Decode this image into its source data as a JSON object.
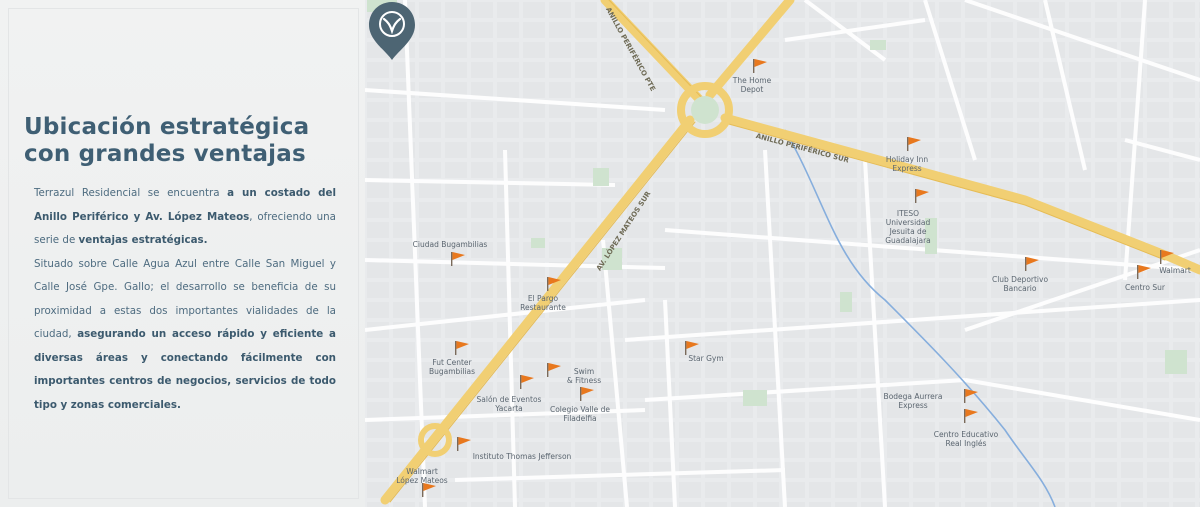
{
  "headline": {
    "line1": "Ubicación estratégica",
    "line2": "con grandes ventajas"
  },
  "body": {
    "p1_a": "Terrazul Residencial se encuentra ",
    "p1_b": "a un costado del Anillo Periférico y Av. López Mateos",
    "p1_c": ", ofreciendo una serie de ",
    "p1_d": "ventajas estratégicas.",
    "p2_a": "Situado sobre Calle Agua Azul entre Calle San Miguel y Calle José Gpe. Gallo; el desarrollo se beneficia de su proximidad a estas dos importantes vialidades de la ciudad, ",
    "p2_b": "asegurando un acceso rápido y eficiente a diversas áreas y conectando fácilmente con importantes centros de negocios, servicios de todo tipo y zonas comerciales."
  },
  "roads": {
    "anillo_pte": "ANILLO PERIFÉRICO PTE",
    "anillo_sur": "ANILLO PERIFÉRICO SUR",
    "lopez_mateos": "AV. LÓPEZ MATEOS SUR"
  },
  "pois": [
    {
      "id": "home-depot",
      "label": "The Home\nDepot"
    },
    {
      "id": "holiday-inn",
      "label": "Holiday Inn\nExpress"
    },
    {
      "id": "iteso",
      "label": "ITESO\nUniversidad\nJesuita de\nGuadalajara"
    },
    {
      "id": "walmart-sur",
      "label": "Walmart"
    },
    {
      "id": "centro-sur",
      "label": "Centro Sur"
    },
    {
      "id": "club-deportivo",
      "label": "Club Deportivo\nBancario"
    },
    {
      "id": "ciudad-bugambilias",
      "label": "Ciudad Bugambilias"
    },
    {
      "id": "el-pargo",
      "label": "El Pargo\nRestaurante"
    },
    {
      "id": "fut-center",
      "label": "Fut Center\nBugambilias"
    },
    {
      "id": "swim-fitness",
      "label": "Swim\n& Fitness"
    },
    {
      "id": "star-gym",
      "label": "Star Gym"
    },
    {
      "id": "salon-eventos",
      "label": "Salón de Eventos\nYacarta"
    },
    {
      "id": "colegio-valle",
      "label": "Colegio Valle de\nFiladelfia"
    },
    {
      "id": "instituto-jefferson",
      "label": "Instituto Thomas Jefferson"
    },
    {
      "id": "walmart-lopez",
      "label": "Walmart\nLópez Mateos"
    },
    {
      "id": "bodega-aurrera",
      "label": "Bodega Aurrera\nExpress"
    },
    {
      "id": "centro-educativo",
      "label": "Centro Educativo\nReal Inglés"
    }
  ],
  "colors": {
    "headline": "#3f5f74",
    "highway": "#f1cf73",
    "poi_flag": "#e8781e",
    "pin": "#4d6573",
    "river": "#86aedd"
  }
}
